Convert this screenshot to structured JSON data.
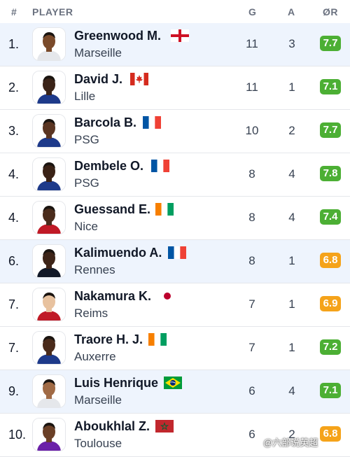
{
  "header": {
    "rank": "#",
    "player": "PLAYER",
    "goals": "G",
    "assists": "A",
    "rating": "ØR"
  },
  "colors": {
    "green": "#4caf34",
    "orange": "#f5a31a",
    "highlight": "#eef4fd"
  },
  "players": [
    {
      "rank": "1.",
      "name": "Greenwood M.",
      "club": "Marseille",
      "flag": "england",
      "g": "11",
      "a": "3",
      "rating": "7.7",
      "rating_color": "green",
      "highlight": true
    },
    {
      "rank": "2.",
      "name": "David J.",
      "club": "Lille",
      "flag": "canada",
      "g": "11",
      "a": "1",
      "rating": "7.1",
      "rating_color": "green",
      "highlight": false
    },
    {
      "rank": "3.",
      "name": "Barcola B.",
      "club": "PSG",
      "flag": "france",
      "g": "10",
      "a": "2",
      "rating": "7.7",
      "rating_color": "green",
      "highlight": false
    },
    {
      "rank": "4.",
      "name": "Dembele O.",
      "club": "PSG",
      "flag": "france",
      "g": "8",
      "a": "4",
      "rating": "7.8",
      "rating_color": "green",
      "highlight": false
    },
    {
      "rank": "4.",
      "name": "Guessand E.",
      "club": "Nice",
      "flag": "ivory-coast",
      "g": "8",
      "a": "4",
      "rating": "7.4",
      "rating_color": "green",
      "highlight": false
    },
    {
      "rank": "6.",
      "name": "Kalimuendo A.",
      "club": "Rennes",
      "flag": "france",
      "g": "8",
      "a": "1",
      "rating": "6.8",
      "rating_color": "orange",
      "highlight": true
    },
    {
      "rank": "7.",
      "name": "Nakamura K.",
      "club": "Reims",
      "flag": "japan",
      "g": "7",
      "a": "1",
      "rating": "6.9",
      "rating_color": "orange",
      "highlight": false
    },
    {
      "rank": "7.",
      "name": "Traore H. J.",
      "club": "Auxerre",
      "flag": "ivory-coast",
      "g": "7",
      "a": "1",
      "rating": "7.2",
      "rating_color": "green",
      "highlight": false
    },
    {
      "rank": "9.",
      "name": "Luis Henrique",
      "club": "Marseille",
      "flag": "brazil",
      "g": "6",
      "a": "4",
      "rating": "7.1",
      "rating_color": "green",
      "highlight": true
    },
    {
      "rank": "10.",
      "name": "Aboukhlal Z.",
      "club": "Toulouse",
      "flag": "morocco",
      "g": "6",
      "a": "2",
      "rating": "6.8",
      "rating_color": "orange",
      "highlight": false
    }
  ],
  "watermark": "@六部说英超"
}
